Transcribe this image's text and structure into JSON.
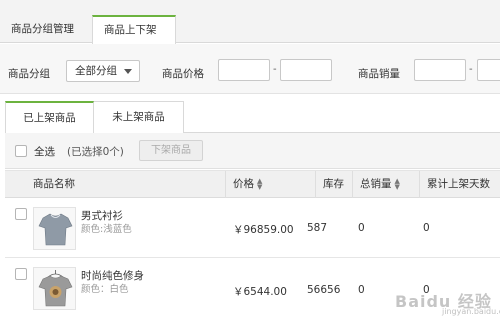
{
  "top_tabs": [
    "商品分组管理",
    "商品上下架"
  ],
  "filters": {
    "group_label": "商品分组",
    "group_value": "全部分组",
    "price_label": "商品价格",
    "sales_label": "商品销量",
    "range_sep": "-"
  },
  "sub_tabs": [
    "已上架商品",
    "未上架商品"
  ],
  "bulk": {
    "select_all": "全选",
    "selected_count": "(已选择0个)",
    "unlist_button": "下架商品"
  },
  "table": {
    "headers": [
      "商品名称",
      "价格",
      "库存",
      "总销量",
      "累计上架天数"
    ],
    "rows": [
      {
        "name": "男式衬衫",
        "color": "颜色:浅蓝色",
        "price": "￥96859.00",
        "stock": "587",
        "sales": "0",
        "days": "0"
      },
      {
        "name": "时尚纯色修身",
        "color": "颜色：白色",
        "price": "￥6544.00",
        "stock": "56656",
        "sales": "0",
        "days": "0"
      }
    ]
  },
  "watermark": {
    "text": "Baidu 经验",
    "sub": "jingyan.baidu.com"
  },
  "colors": {
    "accent": "#6cb33f"
  },
  "icons": {
    "sort": "sort-icon",
    "dropdown": "caret-down-icon",
    "product": "tshirt-icon"
  }
}
